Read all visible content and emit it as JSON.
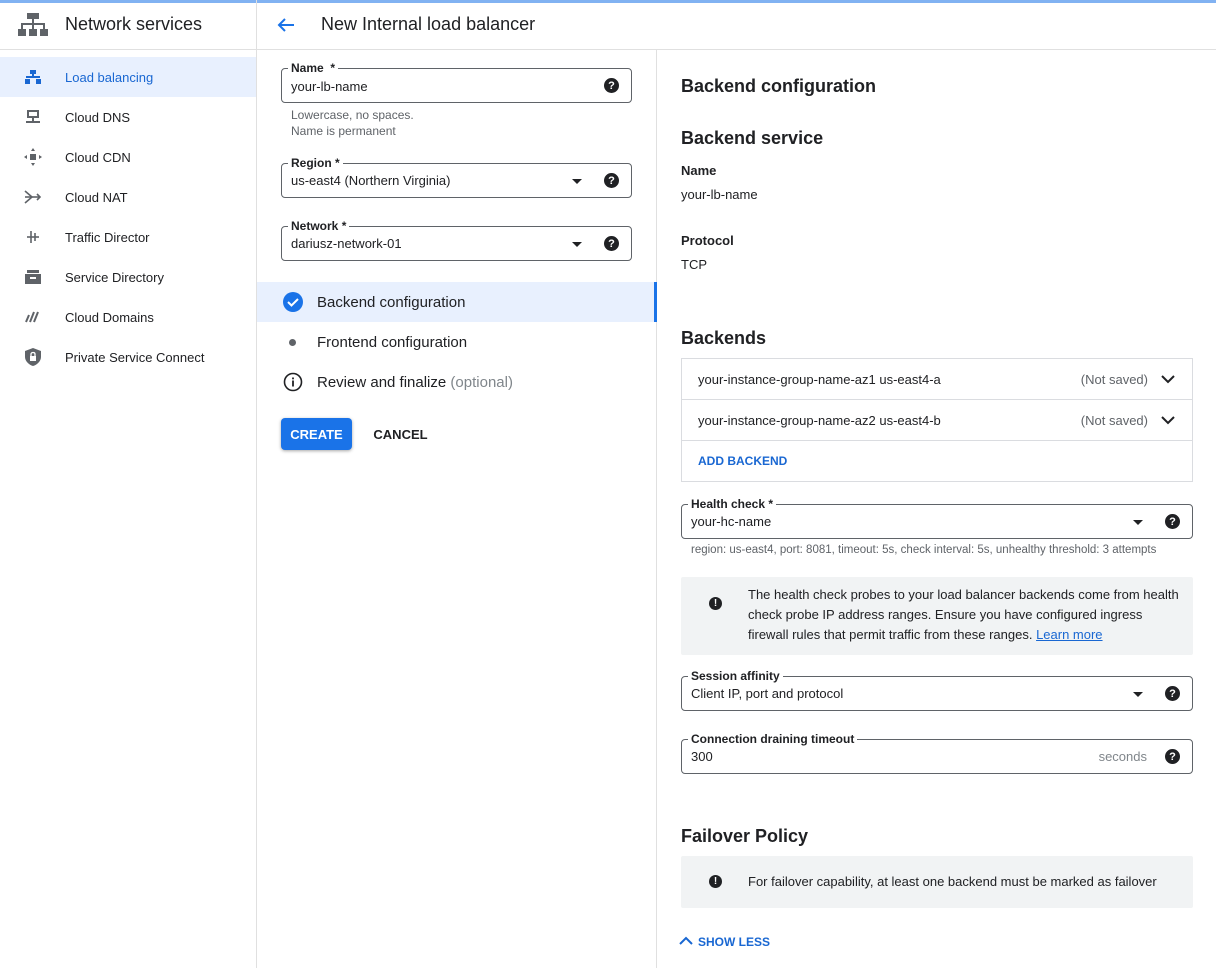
{
  "sidebar": {
    "title": "Network services",
    "items": [
      {
        "label": "Load balancing",
        "icon": "load-balancing-icon"
      },
      {
        "label": "Cloud DNS",
        "icon": "cloud-dns-icon"
      },
      {
        "label": "Cloud CDN",
        "icon": "cloud-cdn-icon"
      },
      {
        "label": "Cloud NAT",
        "icon": "cloud-nat-icon"
      },
      {
        "label": "Traffic Director",
        "icon": "traffic-director-icon"
      },
      {
        "label": "Service Directory",
        "icon": "service-directory-icon"
      },
      {
        "label": "Cloud Domains",
        "icon": "cloud-domains-icon"
      },
      {
        "label": "Private Service Connect",
        "icon": "private-service-connect-icon"
      }
    ]
  },
  "header": {
    "title": "New Internal load balancer"
  },
  "form": {
    "name": {
      "label": "Name",
      "required": "*",
      "value": "your-lb-name",
      "hint1": "Lowercase, no spaces.",
      "hint2": "Name is permanent"
    },
    "region": {
      "label": "Region",
      "required": "*",
      "value": "us-east4 (Northern Virginia)"
    },
    "network": {
      "label": "Network",
      "required": "*",
      "value": "dariusz-network-01"
    }
  },
  "steps": [
    {
      "label": "Backend configuration",
      "state": "complete"
    },
    {
      "label": "Frontend configuration",
      "state": "pending"
    },
    {
      "label": "Review and finalize",
      "optional": "(optional)",
      "state": "info"
    }
  ],
  "actions": {
    "create": "CREATE",
    "cancel": "CANCEL"
  },
  "panel": {
    "title": "Backend configuration",
    "service_title": "Backend service",
    "name_label": "Name",
    "name_value": "your-lb-name",
    "protocol_label": "Protocol",
    "protocol_value": "TCP",
    "backends_title": "Backends",
    "backends": [
      {
        "name": "your-instance-group-name-az1 us-east4-a",
        "status": "(Not saved)"
      },
      {
        "name": "your-instance-group-name-az2 us-east4-b",
        "status": "(Not saved)"
      }
    ],
    "add_backend": "ADD BACKEND",
    "health_check": {
      "label": "Health check",
      "required": "*",
      "value": "your-hc-name",
      "hint": "region: us-east4, port: 8081, timeout: 5s, check interval: 5s, unhealthy threshold: 3 attempts"
    },
    "health_info": "The health check probes to your load balancer backends come from health check probe IP address ranges. Ensure you have configured ingress firewall rules that permit traffic from these ranges.",
    "learn_more": "Learn more",
    "session_affinity": {
      "label": "Session affinity",
      "value": "Client IP, port and protocol"
    },
    "draining": {
      "label": "Connection draining timeout",
      "value": "300",
      "suffix": "seconds"
    },
    "failover_title": "Failover Policy",
    "failover_info": "For failover capability, at least one backend must be marked as failover",
    "show_less": "SHOW LESS"
  },
  "colors": {
    "accent": "#1a73e8",
    "active_bg": "#e8f0fe",
    "link": "#1967d2"
  }
}
